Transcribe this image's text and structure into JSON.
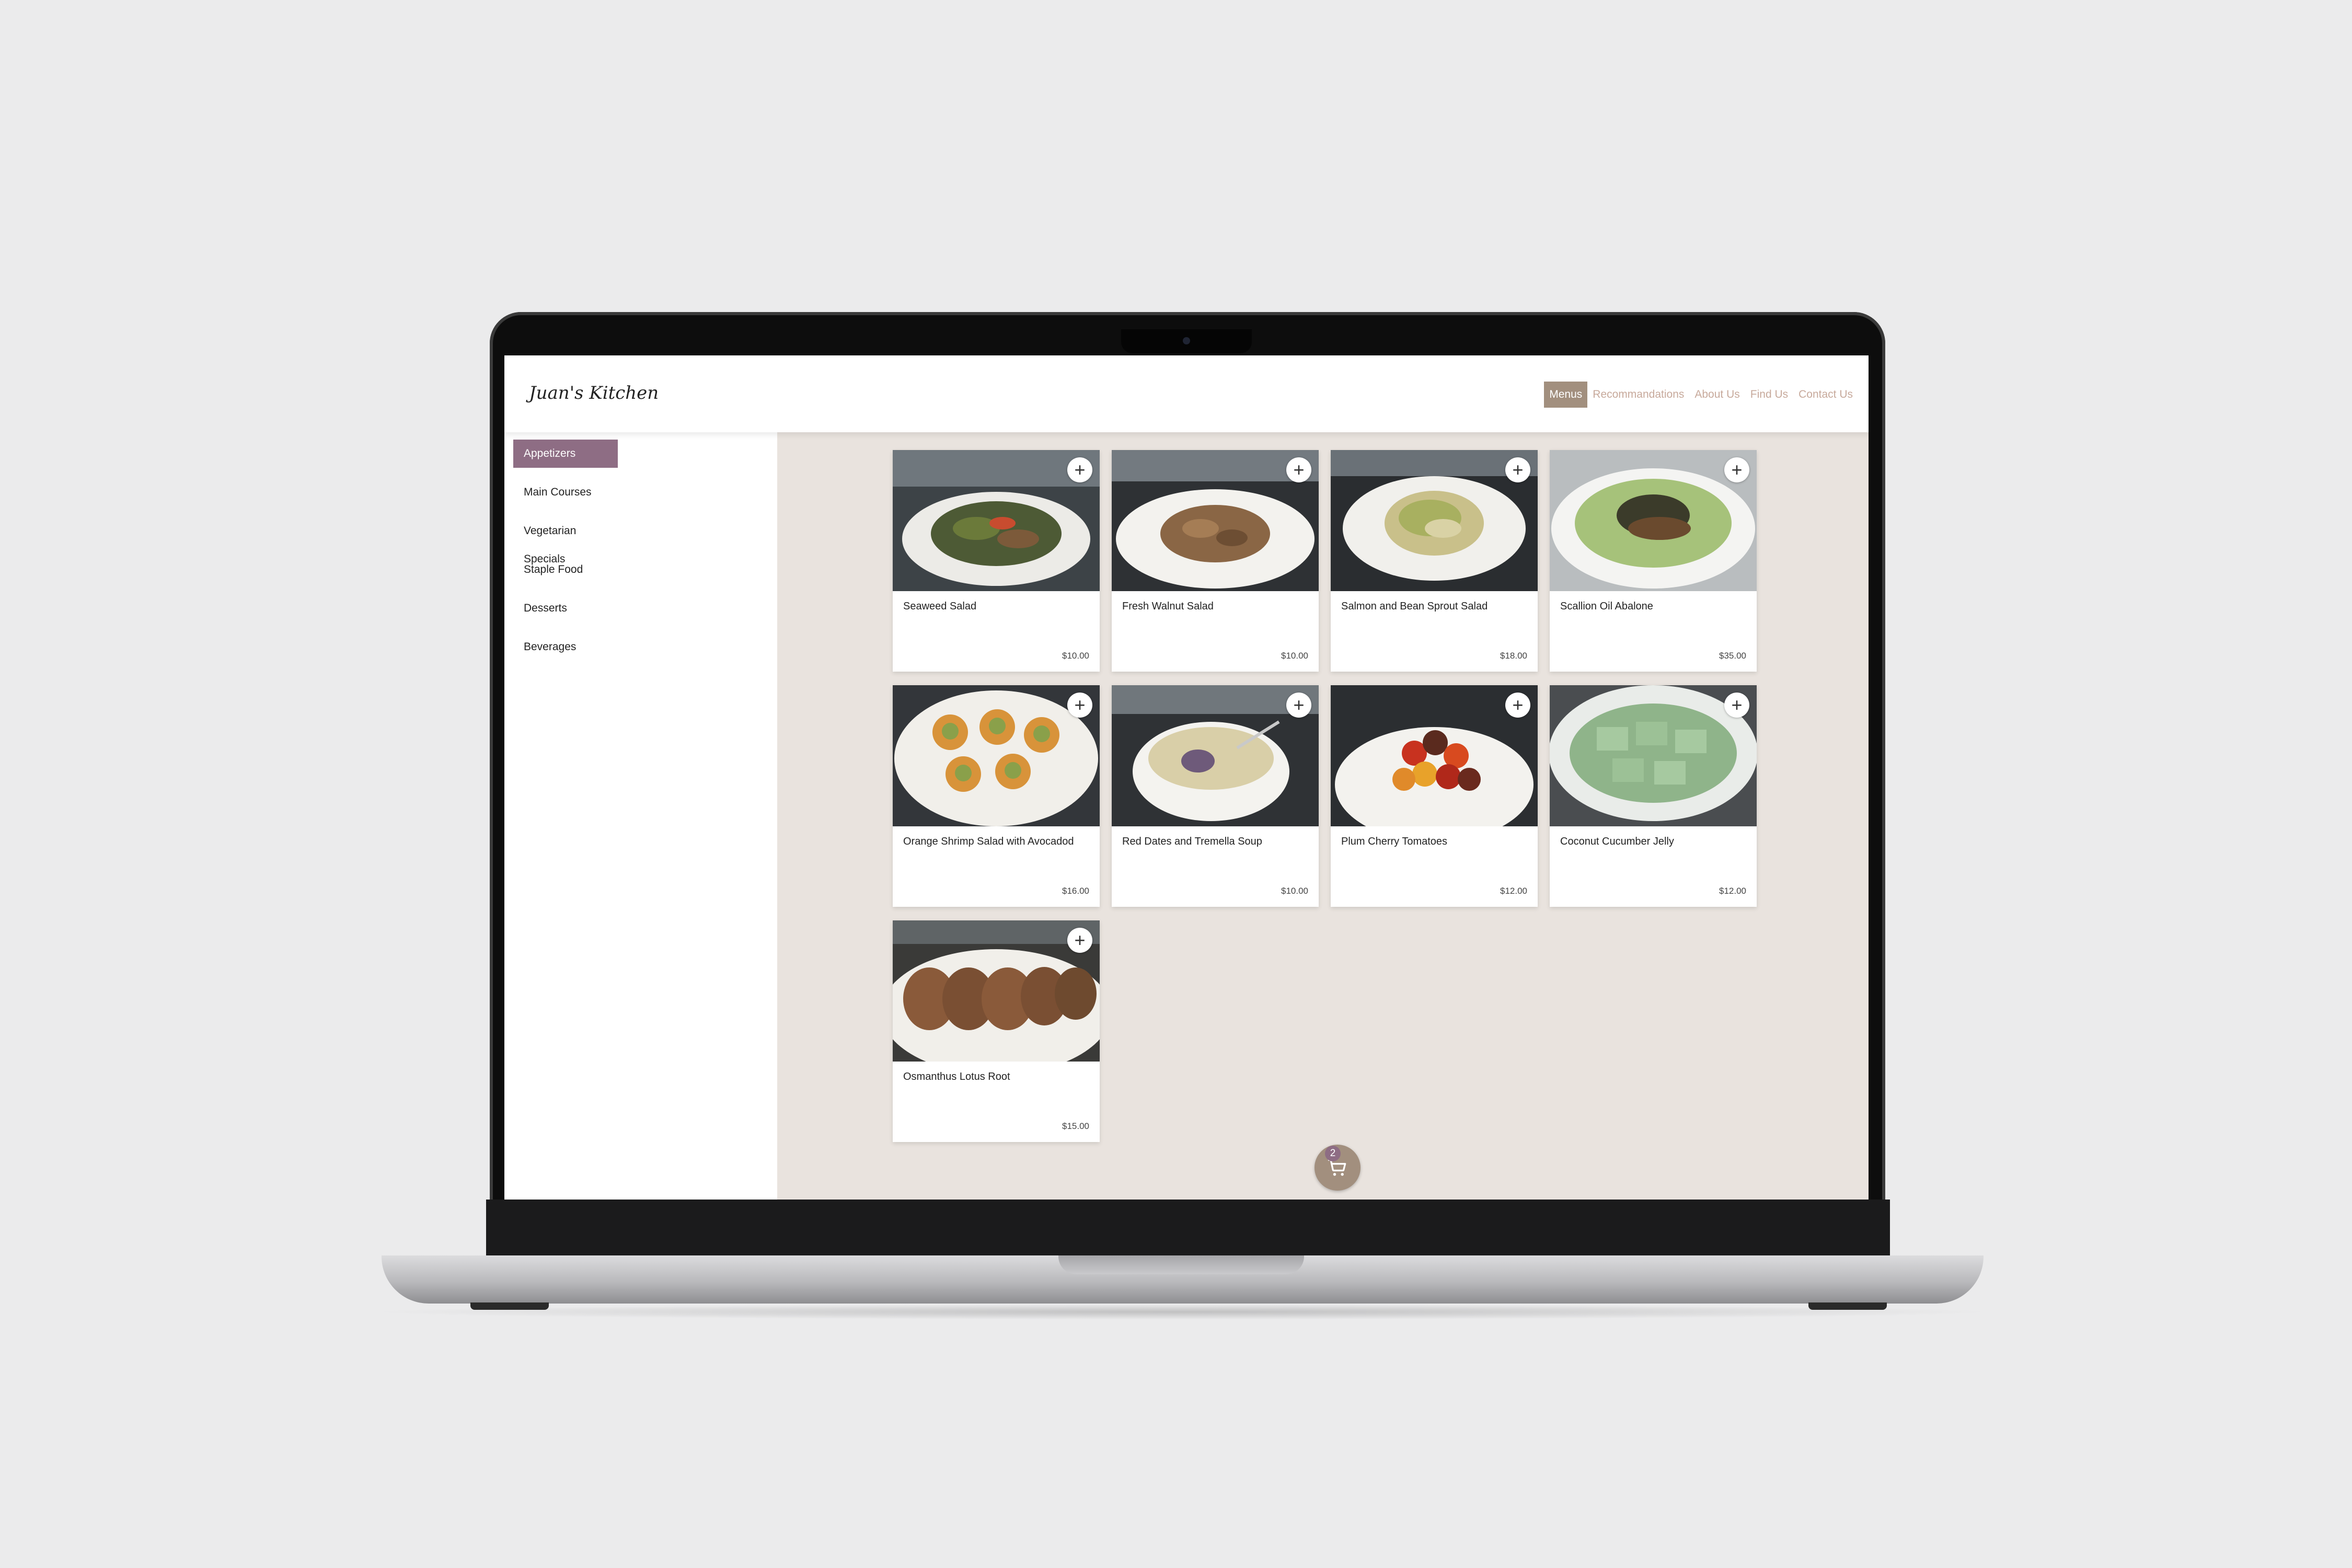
{
  "header": {
    "logo": "Juan's Kitchen",
    "nav": [
      "Menus",
      "Recommandations",
      "About Us",
      "Find Us",
      "Contact Us"
    ],
    "active_nav": "Menus"
  },
  "sidebar": {
    "categories": [
      "Appetizers",
      "Main Courses",
      "Vegetarian Specials",
      "Staple Food",
      "Desserts",
      "Beverages"
    ],
    "active_category": "Appetizers"
  },
  "menu": {
    "items": [
      {
        "name": "Seaweed Salad",
        "price": "$10.00"
      },
      {
        "name": "Fresh Walnut Salad",
        "price": "$10.00"
      },
      {
        "name": "Salmon and Bean Sprout Salad",
        "price": "$18.00"
      },
      {
        "name": "Scallion Oil Abalone",
        "price": "$35.00"
      },
      {
        "name": "Orange Shrimp Salad with Avocadod",
        "price": "$16.00"
      },
      {
        "name": "Red Dates and Tremella Soup",
        "price": "$10.00"
      },
      {
        "name": "Plum Cherry Tomatoes",
        "price": "$12.00"
      },
      {
        "name": "Coconut Cucumber Jelly",
        "price": "$12.00"
      },
      {
        "name": "Osmanthus Lotus Root",
        "price": "$15.00"
      }
    ],
    "add_symbol": "+"
  },
  "cart": {
    "count": "2",
    "icon": "cart-icon"
  },
  "colors": {
    "accent_mauve": "#8e6d84",
    "accent_taupe": "#a28f7e",
    "nav_text": "#c7a99b",
    "content_bg": "#e9e3de"
  }
}
